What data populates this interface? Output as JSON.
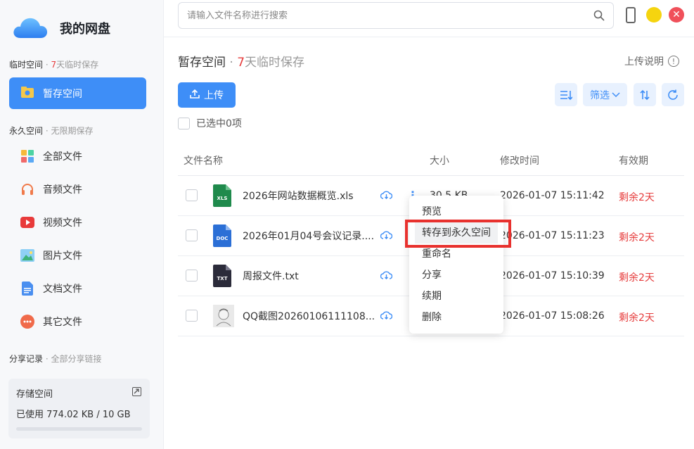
{
  "app": {
    "title": "我的网盘"
  },
  "sidebar": {
    "temp_section": {
      "label": "临时空间",
      "sep": " · ",
      "days": "7",
      "suffix": "天临时保存"
    },
    "temp_item": {
      "label": "暂存空间"
    },
    "perm_section": {
      "label": "永久空间",
      "sep": " · ",
      "note": "无限期保存"
    },
    "items": [
      {
        "label": "全部文件",
        "icon": "grid-icon"
      },
      {
        "label": "音频文件",
        "icon": "headphones-icon"
      },
      {
        "label": "视频文件",
        "icon": "play-icon"
      },
      {
        "label": "图片文件",
        "icon": "image-icon"
      },
      {
        "label": "文档文件",
        "icon": "document-icon"
      },
      {
        "label": "其它文件",
        "icon": "more-icon"
      }
    ],
    "share_section": {
      "label": "分享记录",
      "sep": " · ",
      "note": "全部分享链接"
    },
    "storage": {
      "title": "存储空间",
      "used": "已使用 774.02 KB / 10 GB",
      "fraction": 0.0001
    }
  },
  "search": {
    "placeholder": "请输入文件名称进行搜索",
    "value": ""
  },
  "main": {
    "title": "暂存空间",
    "title_sep": " · ",
    "title_days": "7",
    "title_suffix": "天临时保存",
    "upload_help": "上传说明",
    "upload_label": "上传",
    "filter_label": "筛选",
    "selected_label": "已选中0项"
  },
  "table": {
    "headers": {
      "name": "文件名称",
      "size": "大小",
      "time": "修改时间",
      "expire": "有效期"
    },
    "rows": [
      {
        "name": "2026年网站数据概览.xls",
        "type": "XLS",
        "size": "30.5 KB",
        "time": "2026-01-07 15:11:42",
        "expire": "剩余2天"
      },
      {
        "name": "2026年01月04号会议记录....",
        "type": "DOC",
        "size": "",
        "time": "2026-01-07 15:11:23",
        "expire": "剩余2天"
      },
      {
        "name": "周报文件.txt",
        "type": "TXT",
        "size": "",
        "time": "2026-01-07 15:10:39",
        "expire": "剩余2天"
      },
      {
        "name": "QQ截图20260106111108...",
        "type": "IMG",
        "size": "",
        "time": "2026-01-07 15:08:26",
        "expire": "剩余2天"
      }
    ]
  },
  "context_menu": {
    "items": [
      "预览",
      "转存到永久空间",
      "重命名",
      "分享",
      "续期",
      "删除"
    ]
  },
  "colors": {
    "accent": "#3e8ef7",
    "danger": "#e63b3b",
    "highlight_box": "#e8312e"
  }
}
